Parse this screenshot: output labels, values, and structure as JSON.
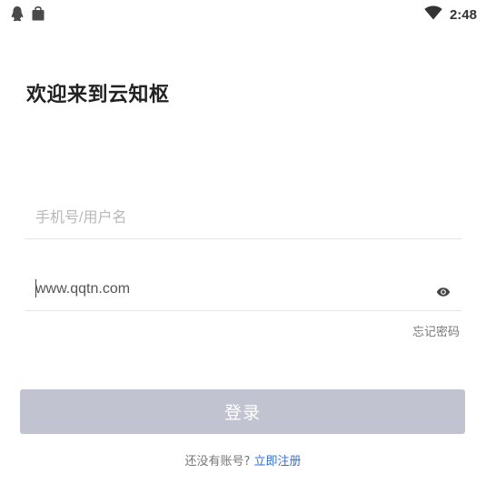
{
  "status_bar": {
    "time": "2:48",
    "icons": [
      "qq-penguin-icon",
      "shopping-bag-icon",
      "wifi-icon"
    ]
  },
  "welcome": {
    "title": "欢迎来到云知枢"
  },
  "form": {
    "username": {
      "placeholder": "手机号/用户名",
      "value": ""
    },
    "password": {
      "value": "www.qqtn.com",
      "toggle_icon": "eye-icon"
    },
    "forgot_label": "忘记密码",
    "login_label": "登录"
  },
  "register": {
    "prompt": "还没有账号?",
    "link_label": "立即注册"
  },
  "colors": {
    "login_button_bg": "#c1c4d0",
    "link_blue": "#2f6fd8",
    "divider": "#e4e4e4"
  }
}
